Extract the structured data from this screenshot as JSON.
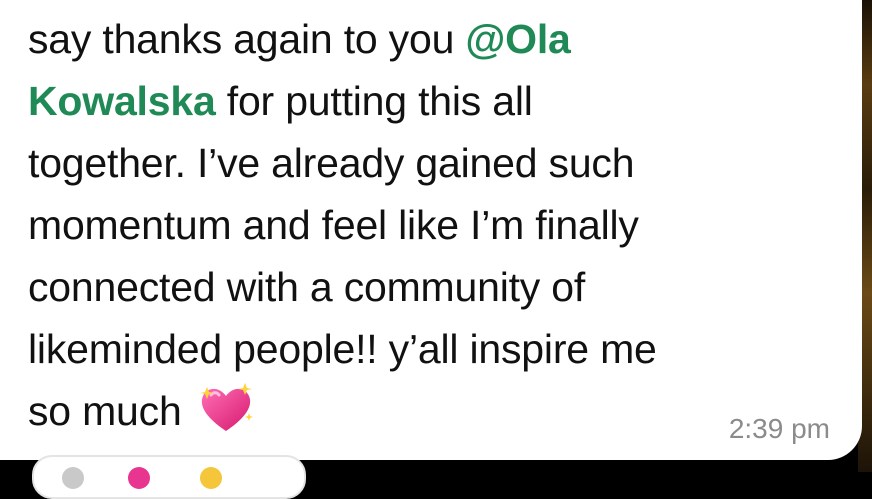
{
  "message": {
    "lines": [
      "say thanks again to you ",
      "for putting this all",
      "together. I’ve already gained such",
      "momentum and feel like I’m finally",
      "connected with a community of",
      "likeminded people!! y’all inspire me",
      "so much "
    ],
    "mention_part1": "@Ola",
    "mention_part2": "Kowalska",
    "emoji": "sparkling-heart-icon",
    "timestamp": "2:39 pm"
  },
  "colors": {
    "mention": "#1f8a55",
    "text": "#111111",
    "timestamp": "#8b8b8b",
    "heart": "#e8358f"
  },
  "reactions": {
    "icons": [
      "face-icon",
      "heart-icon",
      "smile-icon"
    ]
  }
}
